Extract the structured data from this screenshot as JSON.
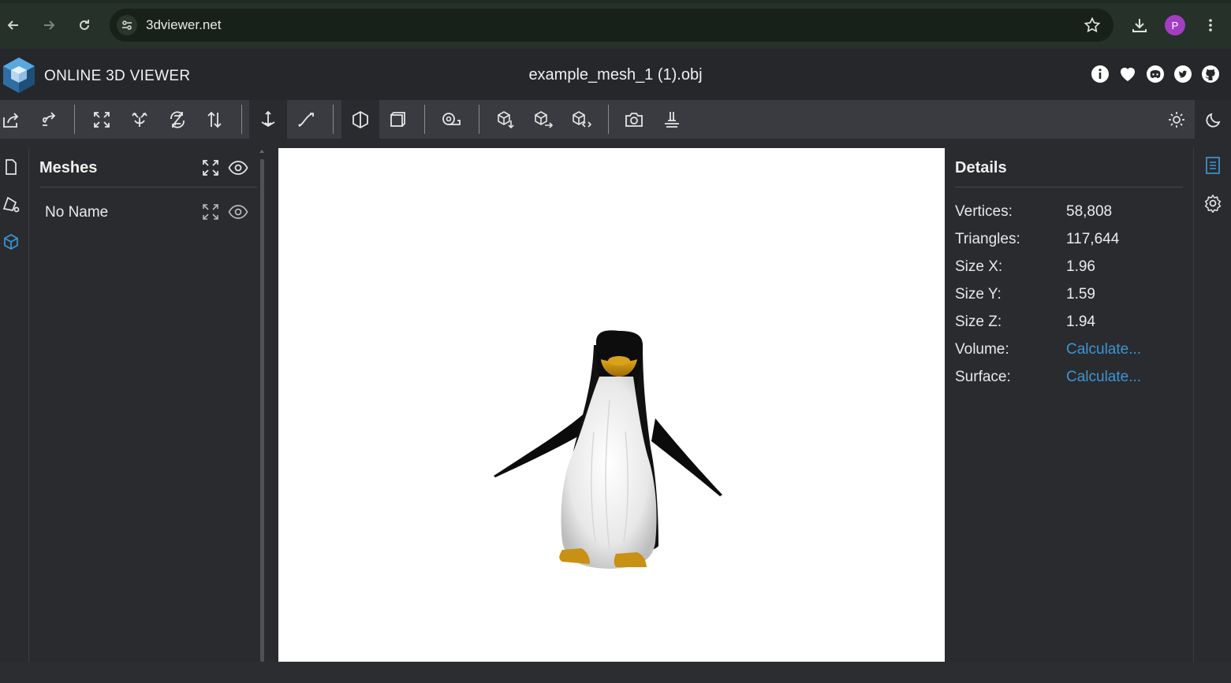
{
  "browser": {
    "url": "3dviewer.net",
    "profile_initial": "P",
    "profile_color": "#a23ec2"
  },
  "header": {
    "app_name": "ONLINE 3D VIEWER",
    "file_name": "example_mesh_1 (1).obj",
    "icons": [
      "info-icon",
      "heart-icon",
      "discord-icon",
      "twitter-icon",
      "github-icon"
    ]
  },
  "toolbar": {
    "tools": [
      "open-file-icon",
      "open-url-icon",
      "fit-to-window-icon",
      "set-up-y-icon",
      "set-up-z-icon",
      "flip-up-icon",
      "fixed-up-orbit-icon",
      "free-orbit-icon",
      "perspective-camera-icon",
      "orthographic-camera-icon",
      "measure-icon",
      "export-icon",
      "share-icon",
      "snapshot-icon",
      "screenshot-icon",
      "embed-icon",
      "light-mode-icon",
      "dark-mode-icon"
    ]
  },
  "meshes": {
    "title": "Meshes",
    "items": [
      {
        "name": "No Name"
      }
    ]
  },
  "details": {
    "title": "Details",
    "rows": [
      {
        "label": "Vertices:",
        "value": "58,808"
      },
      {
        "label": "Triangles:",
        "value": "117,644"
      },
      {
        "label": "Size X:",
        "value": "1.96"
      },
      {
        "label": "Size Y:",
        "value": "1.59"
      },
      {
        "label": "Size Z:",
        "value": "1.94"
      },
      {
        "label": "Volume:",
        "value": "Calculate..."
      },
      {
        "label": "Surface:",
        "value": "Calculate..."
      }
    ]
  },
  "colors": {
    "accent": "#3a96d6",
    "viewport_background": "#ffffff"
  }
}
